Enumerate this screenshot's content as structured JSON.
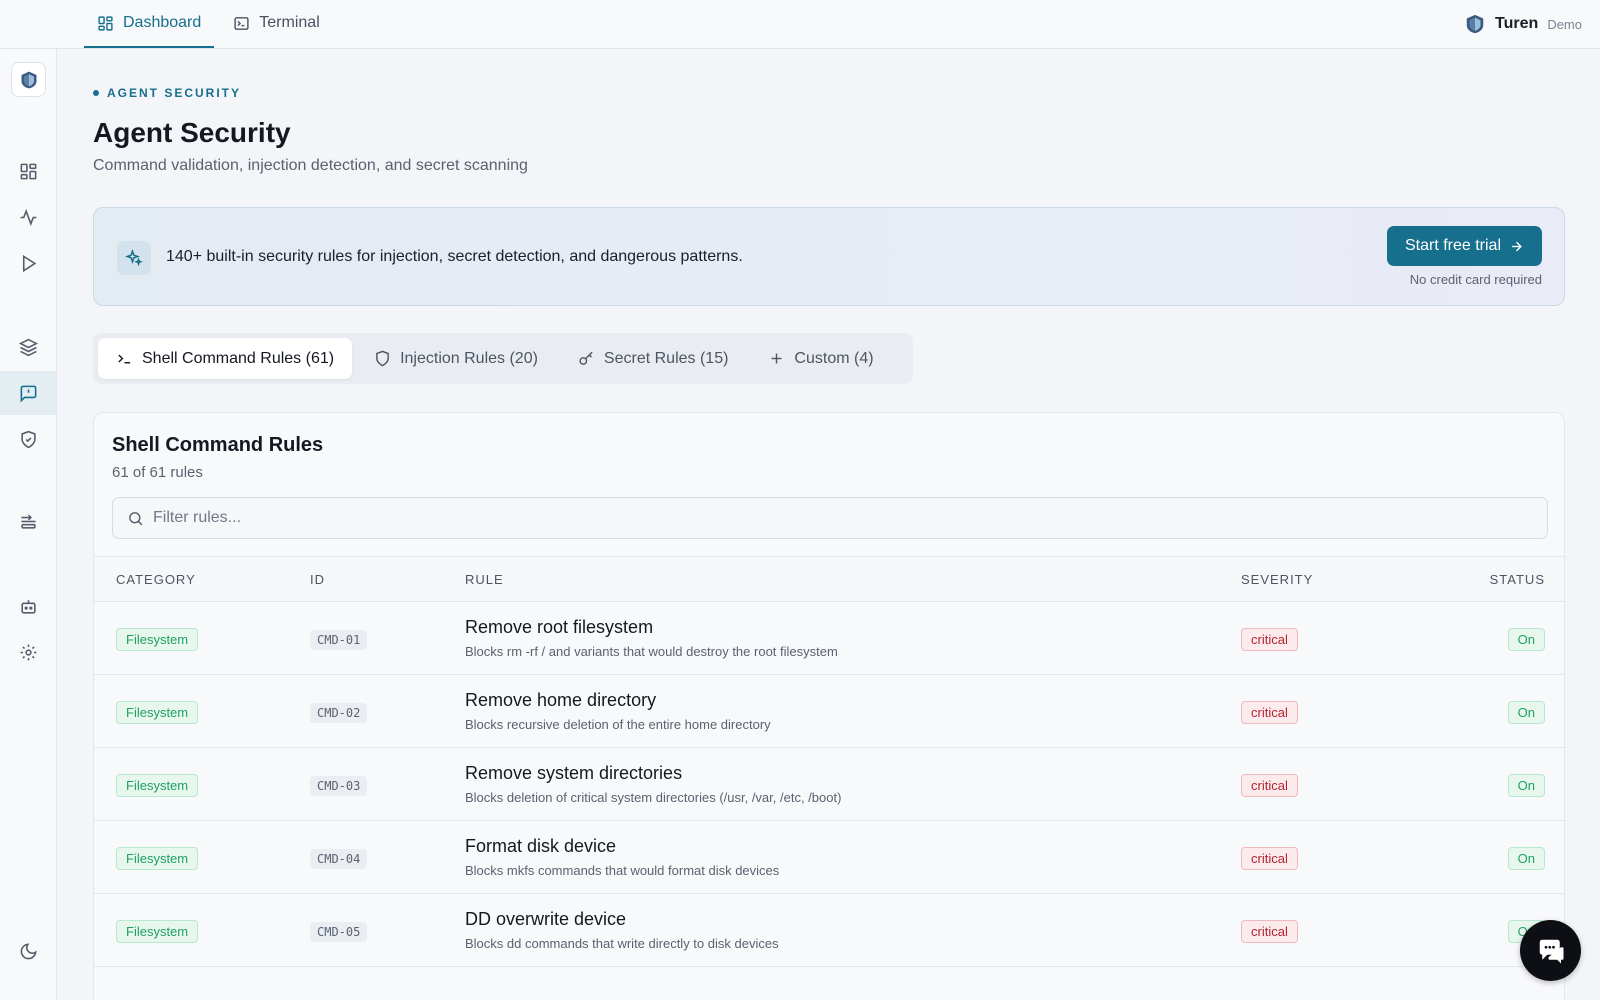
{
  "topnav": {
    "tabs": [
      {
        "label": "Dashboard",
        "icon": "dashboard-icon",
        "active": true
      },
      {
        "label": "Terminal",
        "icon": "terminal-icon",
        "active": false
      }
    ]
  },
  "brand": {
    "name": "Turen",
    "plan": "Demo",
    "icon": "turen-logo-icon"
  },
  "sidebar": {
    "items": [
      {
        "icon": "dashboard-icon"
      },
      {
        "icon": "activity-icon"
      },
      {
        "icon": "play-icon"
      },
      {
        "icon": "layers-icon"
      },
      {
        "icon": "message-alert-icon",
        "active": true
      },
      {
        "icon": "shield-check-icon"
      },
      {
        "icon": "route-icon"
      },
      {
        "icon": "bot-icon"
      },
      {
        "icon": "settings-icon"
      },
      {
        "icon": "moon-icon"
      }
    ]
  },
  "page": {
    "eyebrow": "AGENT SECURITY",
    "title": "Agent Security",
    "subtitle": "Command validation, injection detection, and secret scanning"
  },
  "banner": {
    "text": "140+ built-in security rules for injection, secret detection, and dangerous patterns.",
    "cta_label": "Start free trial",
    "cta_note": "No credit card required"
  },
  "rule_tabs": [
    {
      "label": "Shell Command Rules (61)",
      "icon": "terminal-prompt-icon",
      "active": true
    },
    {
      "label": "Injection Rules (20)",
      "icon": "shield-icon",
      "active": false
    },
    {
      "label": "Secret Rules (15)",
      "icon": "key-icon",
      "active": false
    },
    {
      "label": "Custom (4)",
      "icon": "plus-icon",
      "active": false
    }
  ],
  "card": {
    "title": "Shell Command Rules",
    "count": "61 of 61 rules",
    "filter_placeholder": "Filter rules..."
  },
  "table": {
    "headers": {
      "category": "CATEGORY",
      "id": "ID",
      "rule": "RULE",
      "severity": "SEVERITY",
      "status": "STATUS"
    },
    "rows": [
      {
        "category": "Filesystem",
        "id": "CMD-01",
        "name": "Remove root filesystem",
        "desc": "Blocks rm -rf / and variants that would destroy the root filesystem",
        "severity": "critical",
        "status": "On"
      },
      {
        "category": "Filesystem",
        "id": "CMD-02",
        "name": "Remove home directory",
        "desc": "Blocks recursive deletion of the entire home directory",
        "severity": "critical",
        "status": "On"
      },
      {
        "category": "Filesystem",
        "id": "CMD-03",
        "name": "Remove system directories",
        "desc": "Blocks deletion of critical system directories (/usr, /var, /etc, /boot)",
        "severity": "critical",
        "status": "On"
      },
      {
        "category": "Filesystem",
        "id": "CMD-04",
        "name": "Format disk device",
        "desc": "Blocks mkfs commands that would format disk devices",
        "severity": "critical",
        "status": "On"
      },
      {
        "category": "Filesystem",
        "id": "CMD-05",
        "name": "DD overwrite device",
        "desc": "Blocks dd commands that write directly to disk devices",
        "severity": "critical",
        "status": "On"
      }
    ]
  },
  "colors": {
    "accent": "#156f8d",
    "success": "#21a064",
    "danger": "#b42330"
  }
}
